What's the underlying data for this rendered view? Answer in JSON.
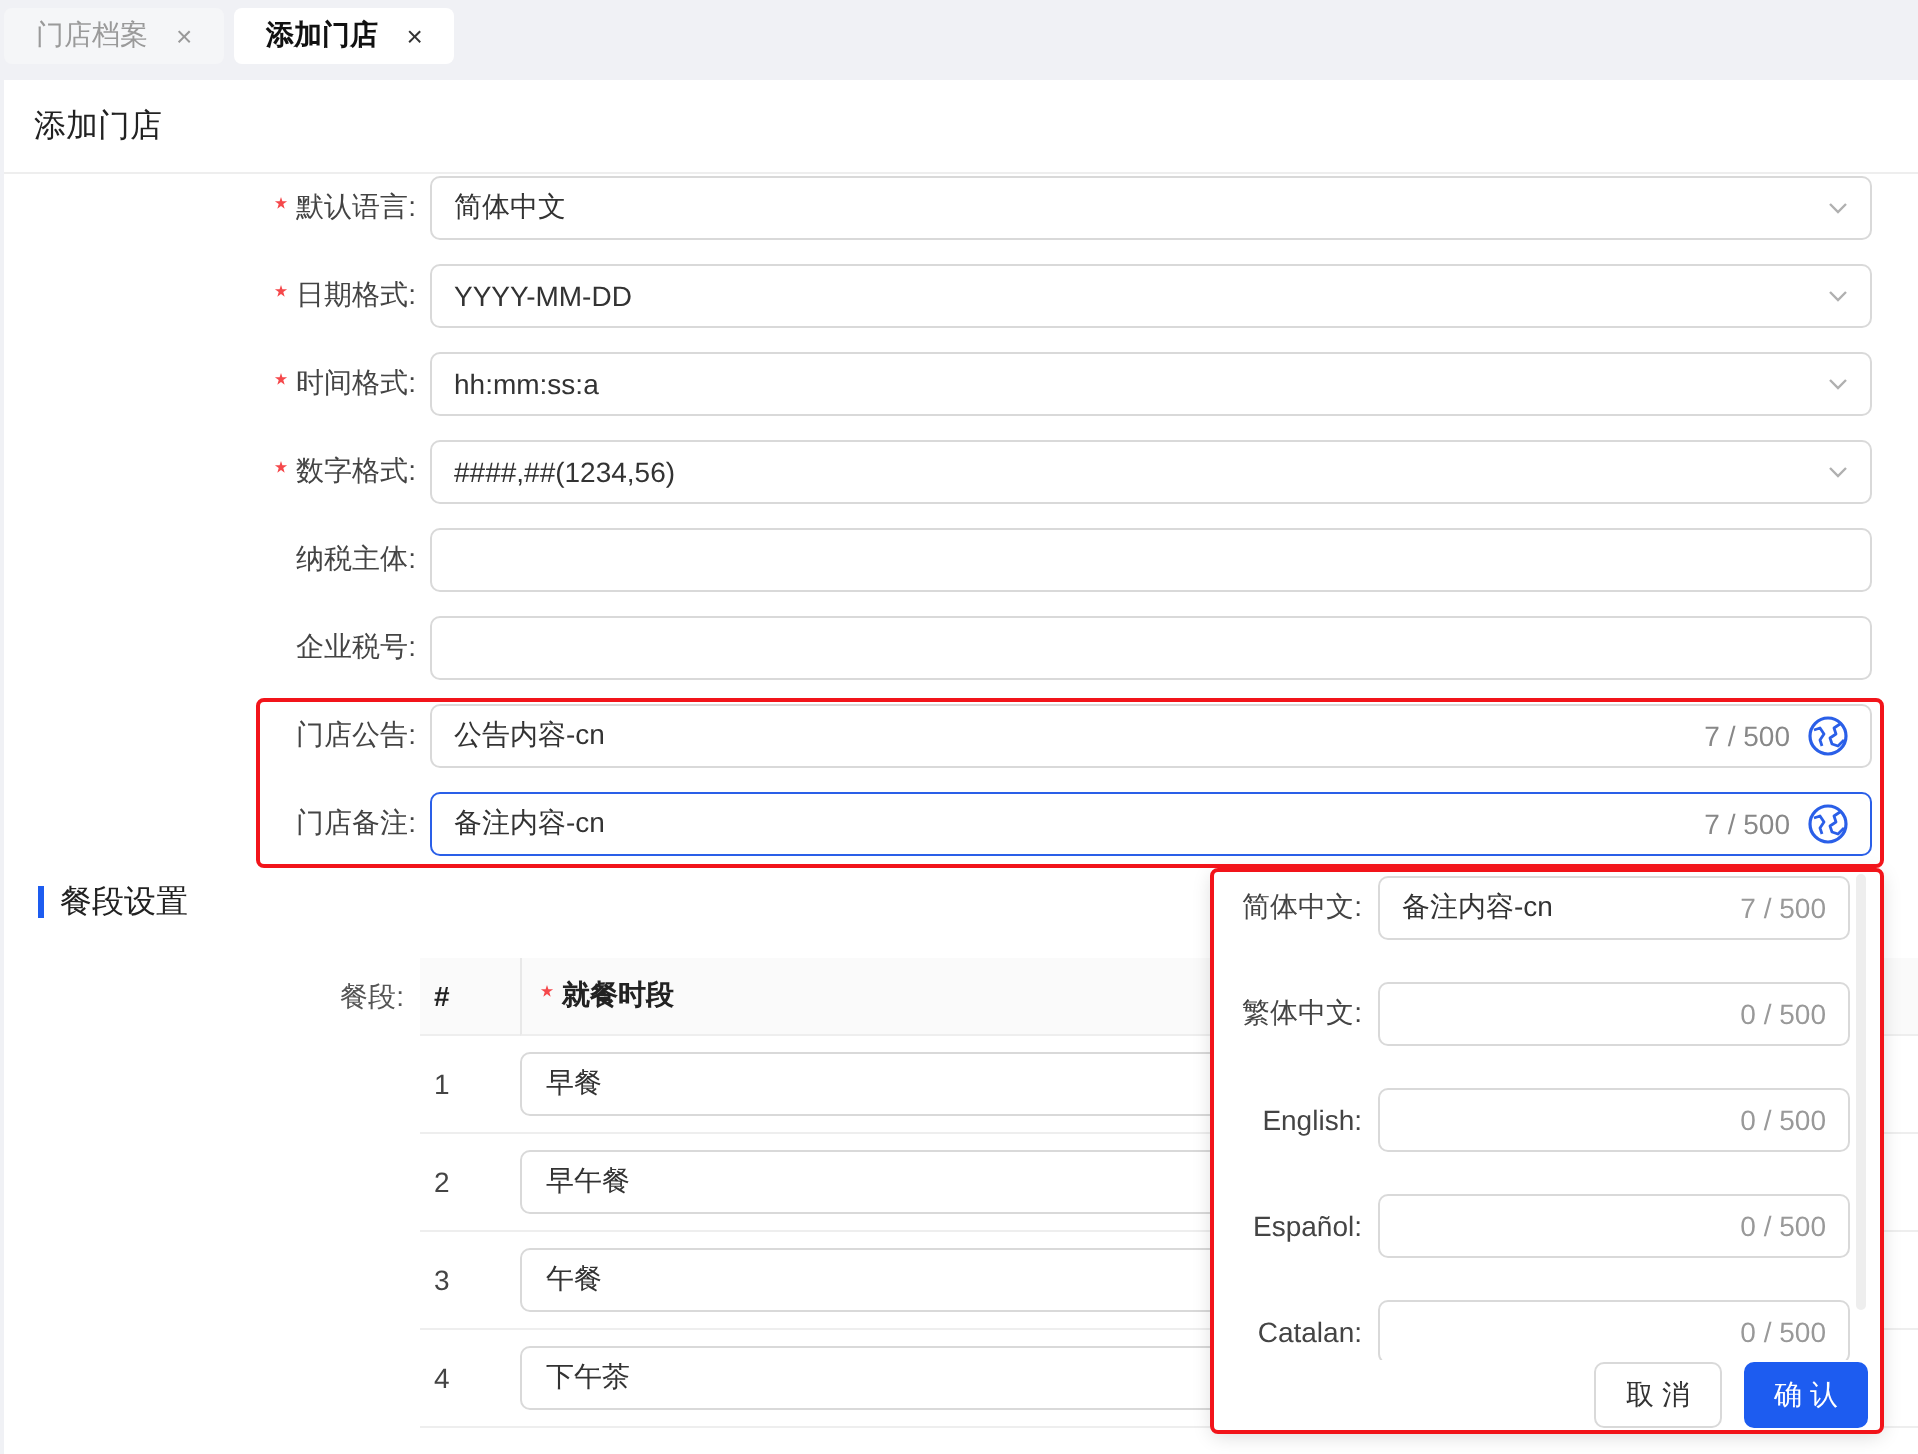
{
  "tabs": [
    {
      "label": "门店档案",
      "selected": false,
      "close": "×"
    },
    {
      "label": "添加门店",
      "selected": true,
      "close": "×"
    }
  ],
  "page_title": "添加门店",
  "form": {
    "fields": [
      {
        "label": "默认语言:",
        "required": true,
        "kind": "select",
        "value": "简体中文"
      },
      {
        "label": "日期格式:",
        "required": true,
        "kind": "select",
        "value": "YYYY-MM-DD"
      },
      {
        "label": "时间格式:",
        "required": true,
        "kind": "select",
        "value": "hh:mm:ss:a"
      },
      {
        "label": "数字格式:",
        "required": true,
        "kind": "select",
        "value": "####,##(1234,56)"
      },
      {
        "label": "纳税主体:",
        "required": false,
        "kind": "input"
      },
      {
        "label": "企业税号:",
        "required": false,
        "kind": "input"
      },
      {
        "label": "门店公告:",
        "required": false,
        "kind": "i18n",
        "value": "公告内容-cn",
        "counter": "7 / 500",
        "focused": false
      },
      {
        "label": "门店备注:",
        "required": false,
        "kind": "i18n",
        "value": "备注内容-cn",
        "counter": "7 / 500",
        "focused": true
      }
    ]
  },
  "meal_section": {
    "title": "餐段设置",
    "table_label": "餐段:",
    "columns": [
      {
        "label": "#",
        "required": false
      },
      {
        "label": "就餐时段",
        "required": true
      }
    ],
    "rows": [
      {
        "index": "1",
        "value": "早餐"
      },
      {
        "index": "2",
        "value": "早午餐"
      },
      {
        "index": "3",
        "value": "午餐"
      },
      {
        "index": "4",
        "value": "下午茶"
      }
    ]
  },
  "translation_popover": {
    "fields": [
      {
        "label": "简体中文:",
        "value": "备注内容-cn",
        "counter": "7 / 500"
      },
      {
        "label": "繁体中文:",
        "counter": "0 / 500"
      },
      {
        "label": "English:",
        "counter": "0 / 500"
      },
      {
        "label": "Español:",
        "counter": "0 / 500"
      },
      {
        "label": "Catalan:",
        "counter": "0 / 500"
      }
    ],
    "buttons": [
      {
        "label": "取 消",
        "kind": "default"
      },
      {
        "label": "确 认",
        "kind": "primary"
      }
    ]
  }
}
